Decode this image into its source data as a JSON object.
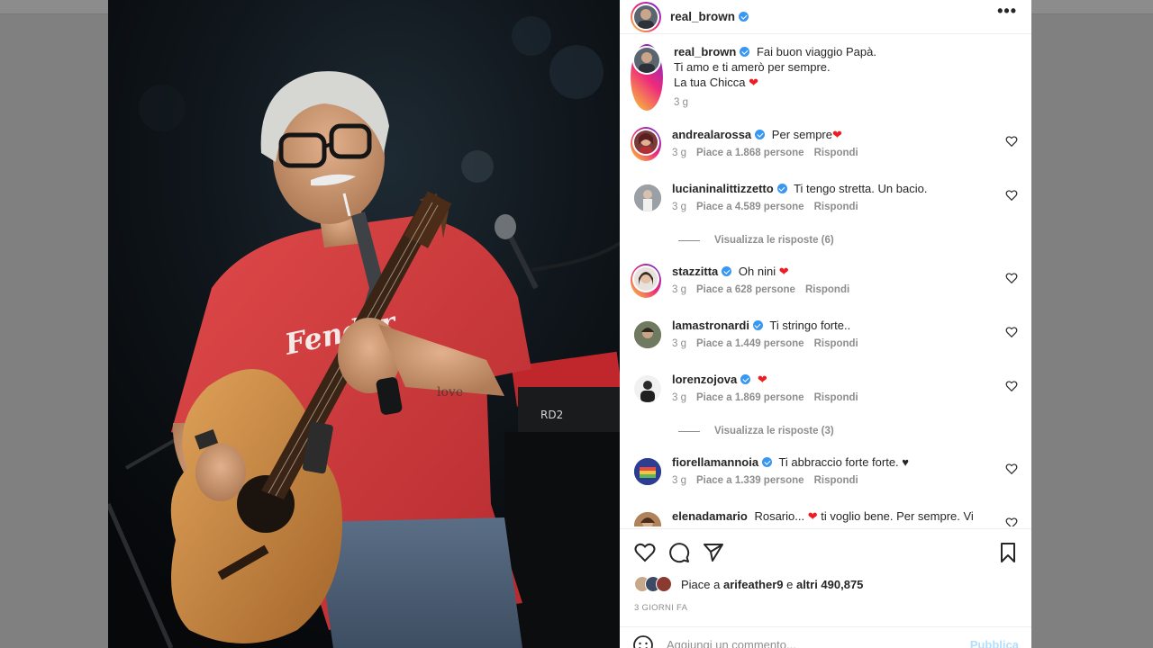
{
  "post": {
    "owner": "real_brown",
    "more_icon": "•••",
    "caption": {
      "user": "real_brown",
      "lines": [
        "Fai buon viaggio Papà.",
        "Ti amo e ti amerò per sempre.",
        "La tua Chicca"
      ],
      "age": "3 g"
    },
    "comments": [
      {
        "user": "andrealarossa",
        "text": "Per sempre",
        "heart": true,
        "age": "3 g",
        "likes": "Piace a 1.868 persone",
        "reply": "Rispondi"
      },
      {
        "user": "lucianinalittizzetto",
        "text": "Ti tengo stretta. Un bacio.",
        "heart": false,
        "age": "3 g",
        "likes": "Piace a 4.589 persone",
        "reply": "Rispondi",
        "view_replies": "Visualizza le risposte (6)"
      },
      {
        "user": "stazzitta",
        "text": "Oh nini",
        "heart": true,
        "age": "3 g",
        "likes": "Piace a 628 persone",
        "reply": "Rispondi"
      },
      {
        "user": "lamastronardi",
        "text": "Ti stringo forte..",
        "heart": false,
        "age": "3 g",
        "likes": "Piace a 1.449 persone",
        "reply": "Rispondi"
      },
      {
        "user": "lorenzojova",
        "text": "",
        "heart": true,
        "age": "3 g",
        "likes": "Piace a 1.869 persone",
        "reply": "Rispondi",
        "view_replies": "Visualizza le risposte (3)"
      },
      {
        "user": "fiorellamannoia",
        "text": "Ti abbraccio forte forte. ♥",
        "heart": false,
        "age": "3 g",
        "likes": "Piace a 1.339 persone",
        "reply": "Rispondi"
      },
      {
        "user": "elenadamario",
        "text": "Rosario...",
        "heart": true,
        "text2": "ti voglio bene. Per sempre. Vi"
      }
    ],
    "likes": {
      "prefix": "Piace a",
      "user": "arifeather9",
      "middle": "e",
      "others": "altri 490,875"
    },
    "time_ago": "3 GIORNI FA",
    "add_comment": {
      "placeholder": "Aggiungi un commento...",
      "publish": "Pubblica"
    }
  },
  "colors": {
    "verified": "#3897f0",
    "heart_red": "#ed1d24",
    "shirt_red": "#d9363a",
    "publish_disabled": "#b2dffc"
  }
}
